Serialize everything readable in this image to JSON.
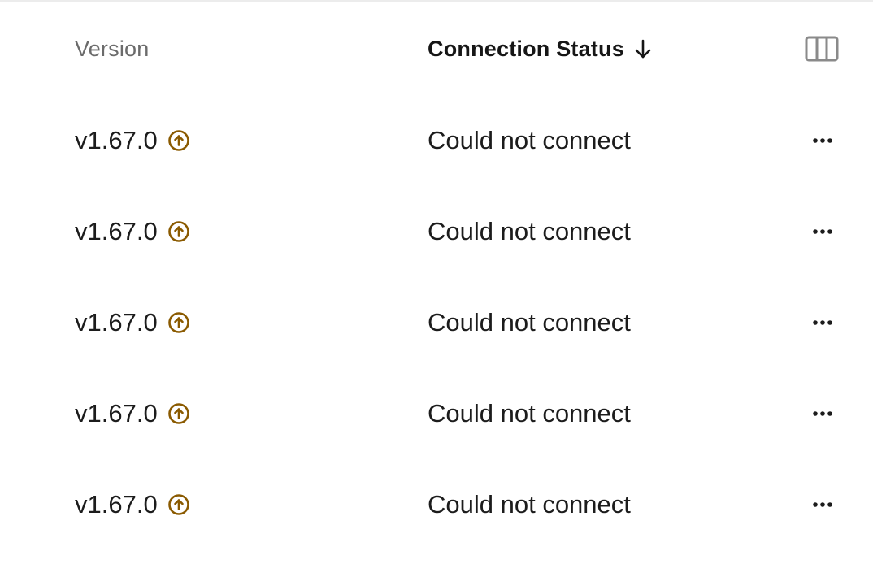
{
  "table": {
    "columns": {
      "version": "Version",
      "connection_status": "Connection Status",
      "sort_direction": "descending",
      "sort_icon": "arrow-down-icon",
      "column_picker_icon": "columns-icon"
    },
    "rows": [
      {
        "version": "v1.67.0",
        "upgrade_icon": "arrow-up-circle-icon",
        "status": "Could not connect",
        "actions_icon": "more-horizontal-icon"
      },
      {
        "version": "v1.67.0",
        "upgrade_icon": "arrow-up-circle-icon",
        "status": "Could not connect",
        "actions_icon": "more-horizontal-icon"
      },
      {
        "version": "v1.67.0",
        "upgrade_icon": "arrow-up-circle-icon",
        "status": "Could not connect",
        "actions_icon": "more-horizontal-icon"
      },
      {
        "version": "v1.67.0",
        "upgrade_icon": "arrow-up-circle-icon",
        "status": "Could not connect",
        "actions_icon": "more-horizontal-icon"
      },
      {
        "version": "v1.67.0",
        "upgrade_icon": "arrow-up-circle-icon",
        "status": "Could not connect",
        "actions_icon": "more-horizontal-icon"
      }
    ]
  },
  "colors": {
    "upgrade_icon": "#8a5a00",
    "header_muted": "#6b6b6b",
    "text": "#1c1c1c",
    "column_icon": "#8a8a8a",
    "divider": "#e6e6e6"
  }
}
